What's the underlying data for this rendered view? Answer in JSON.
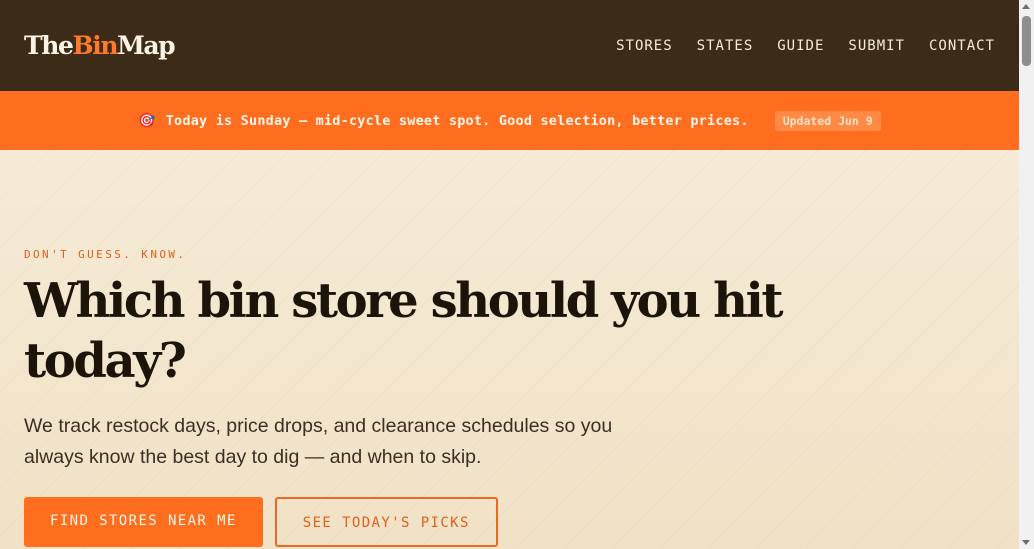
{
  "header": {
    "logo": {
      "part1": "The",
      "part2": "Bin",
      "part3": "Map"
    },
    "nav": [
      "STORES",
      "STATES",
      "GUIDE",
      "SUBMIT",
      "CONTACT"
    ]
  },
  "announcement": {
    "emoji": "🎯",
    "message": "Today is Sunday — mid-cycle sweet spot. Good selection, better prices.",
    "badge": "Updated Jun 9"
  },
  "hero": {
    "eyebrow": "DON'T GUESS. KNOW.",
    "headline": "Which bin store should you hit today?",
    "subtext": "We track restock days, price drops, and clearance schedules so you always know the best day to dig — and when to skip.",
    "primary_cta": "FIND STORES NEAR ME",
    "secondary_cta": "SEE TODAY'S PICKS"
  },
  "colors": {
    "header_bg": "#3c2b16",
    "accent": "#ff6d1f",
    "hero_bg": "#f3e7cf"
  }
}
